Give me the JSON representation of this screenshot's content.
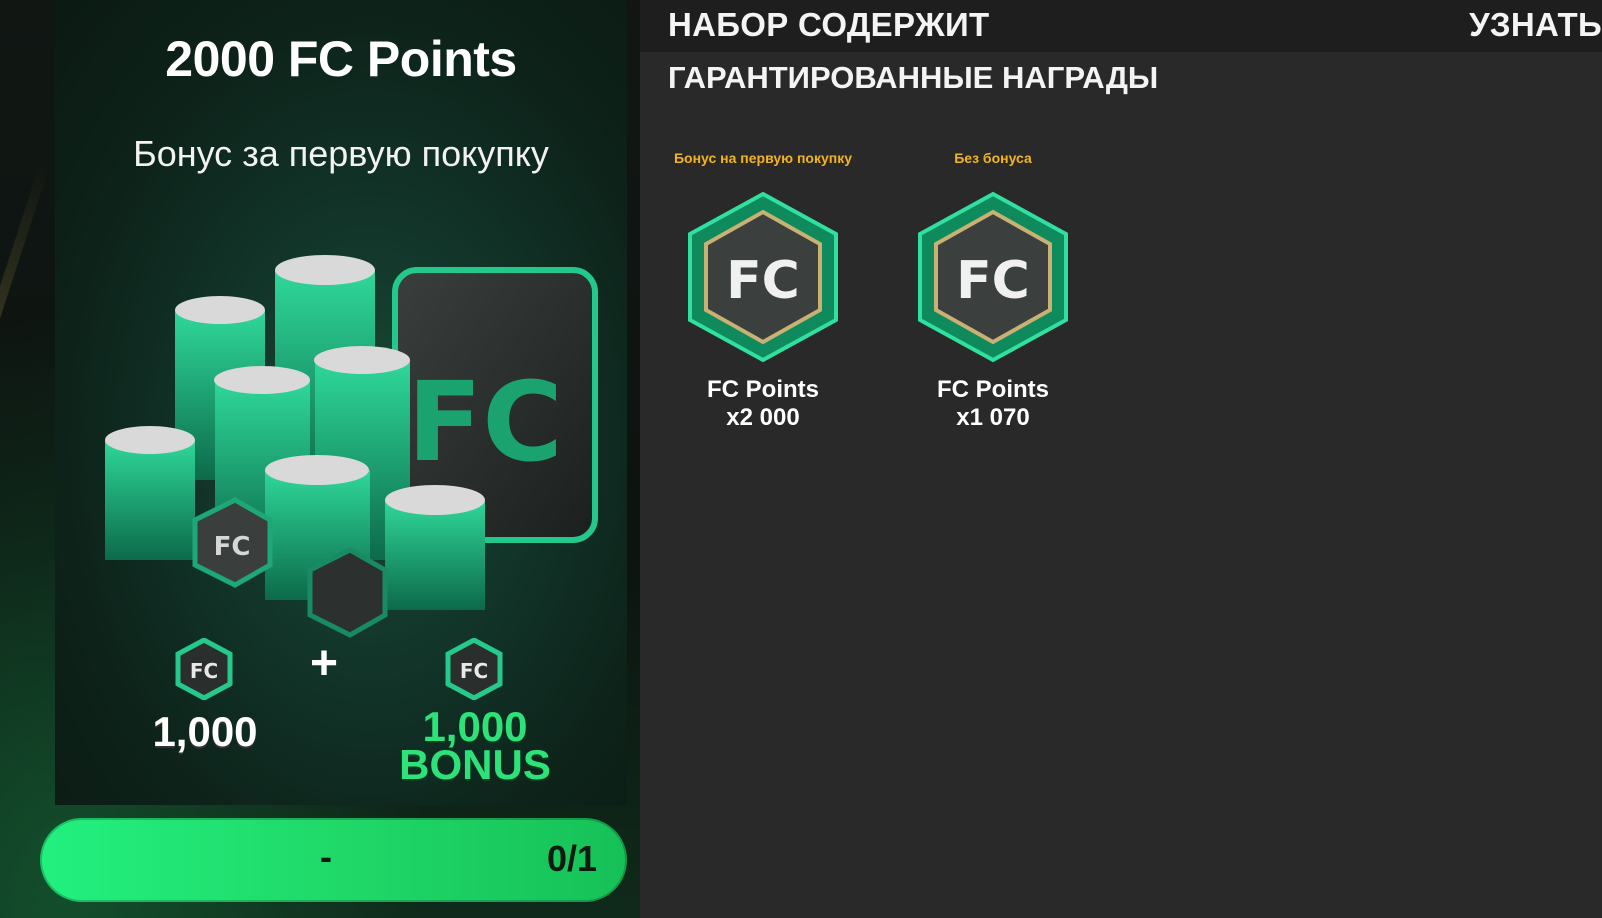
{
  "pack": {
    "title": "2000 FC Points",
    "subtitle": "Бонус за первую покупку",
    "base_amount": "1,000",
    "plus_sign": "+",
    "bonus_amount": "1,000",
    "bonus_label": "BONUS",
    "buy_price": "-",
    "purchase_limit": "0/1"
  },
  "panel": {
    "header_title": "НАБОР СОДЕРЖИТ",
    "header_link": "УЗНАТЬ",
    "section_title": "ГАРАНТИРОВАННЫЕ НАГРАДЫ",
    "rewards": [
      {
        "note": "Бонус на первую покупку",
        "name": "FC Points",
        "quantity": "x2 000"
      },
      {
        "note": "Без бонуса",
        "name": "FC Points",
        "quantity": "x1 070"
      }
    ]
  },
  "colors": {
    "accent_green": "#22f07f",
    "bonus_text": "#2ee27a",
    "note_gold": "#f3b420",
    "panel_bg": "#292929"
  },
  "icons": [
    "fc-points-icon",
    "fc-coin-stack-image"
  ]
}
